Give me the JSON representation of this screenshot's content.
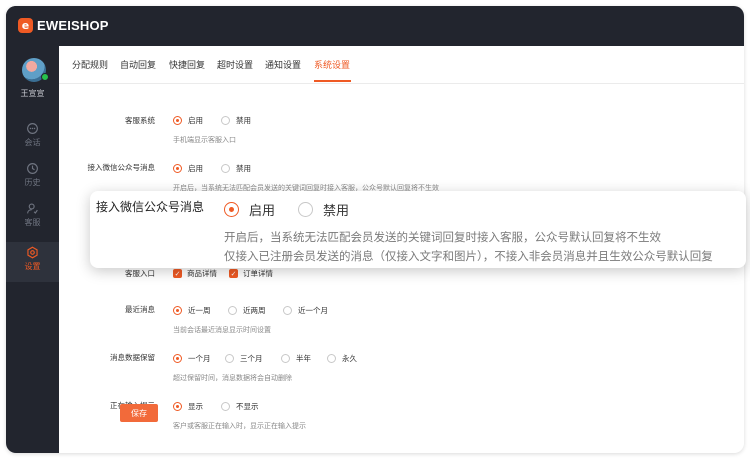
{
  "app": {
    "logo_mark": "e",
    "logo_text": "EWEISHOP",
    "brand_color": "#ef5a24"
  },
  "user": {
    "name": "王宣宣",
    "status_color": "#27c24c"
  },
  "sidebar": {
    "items": [
      {
        "label": "会话",
        "icon": "chat-icon"
      },
      {
        "label": "历史",
        "icon": "clock-icon"
      },
      {
        "label": "客服",
        "icon": "agent-icon"
      },
      {
        "label": "设置",
        "icon": "settings-icon",
        "active": true
      }
    ]
  },
  "tabs": [
    "分配规则",
    "自动回复",
    "快捷回复",
    "超时设置",
    "通知设置",
    "系统设置"
  ],
  "active_tab": "系统设置",
  "settings": {
    "service_system": {
      "label": "客服系统",
      "options": [
        "启用",
        "禁用"
      ],
      "selected": "启用",
      "hint": "手机端显示客服入口"
    },
    "wechat_access": {
      "label": "接入微信公众号消息",
      "options": [
        "启用",
        "禁用"
      ],
      "selected": "启用",
      "hint": "开启后，当系统无法匹配会员发送的关键词回复时接入客服，公众号默认回复将不生效"
    },
    "service_entry": {
      "label": "客服入口",
      "options": [
        "商品详情",
        "订单详情"
      ]
    },
    "recent_messages": {
      "label": "最近消息",
      "options": [
        "近一周",
        "近两周",
        "近一个月"
      ],
      "selected": "近一周",
      "hint": "当前会话最近消息显示时间设置"
    },
    "retention": {
      "label": "消息数据保留",
      "options": [
        "一个月",
        "三个月",
        "半年",
        "永久"
      ],
      "selected": "一个月",
      "hint": "超过保留时间，消息数据将会自动删除"
    },
    "typing_hint": {
      "label": "正在输入提示",
      "options": [
        "显示",
        "不显示"
      ],
      "selected": "显示",
      "hint": "客户或客服正在输入时，显示正在输入提示"
    }
  },
  "save_label": "保存",
  "popup": {
    "label": "接入微信公众号消息",
    "options": [
      "启用",
      "禁用"
    ],
    "selected": "启用",
    "hint_1": "开启后，当系统无法匹配会员发送的关键词回复时接入客服，公众号默认回复将不生效",
    "hint_2": "仅接入已注册会员发送的消息（仅接入文字和图片），不接入非会员消息并且生效公众号默认回复"
  }
}
